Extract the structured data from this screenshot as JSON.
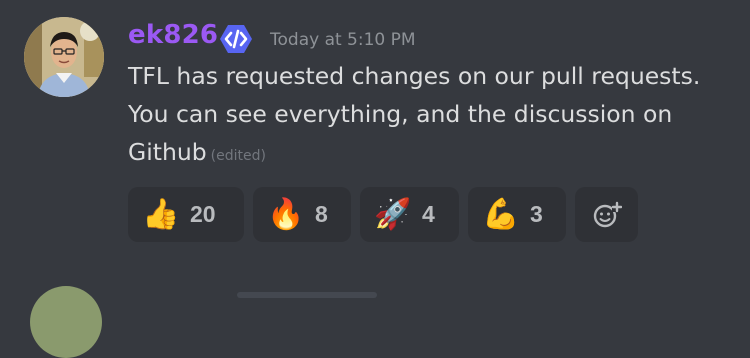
{
  "message": {
    "username": "ek826",
    "badge_icon": "code-brackets-badge-icon",
    "timestamp": "Today at 5:10 PM",
    "lines": [
      "TFL has requested changes on our pull requests.",
      "You can see everything, and the discussion on",
      "Github"
    ],
    "edited_label": "(edited)",
    "colors": {
      "username": "#9b59f3",
      "badge": "#5865f2",
      "background": "#36393f",
      "reaction_background": "#2f3136"
    }
  },
  "reactions": [
    {
      "emoji": "👍",
      "icon": "thumbs-up-icon",
      "count": "20"
    },
    {
      "emoji": "🔥",
      "icon": "fire-icon",
      "count": "8"
    },
    {
      "emoji": "🚀",
      "icon": "rocket-icon",
      "count": "4"
    },
    {
      "emoji": "💪",
      "icon": "flexed-biceps-icon",
      "count": "3"
    }
  ],
  "add_reaction_icon": "add-reaction-icon"
}
